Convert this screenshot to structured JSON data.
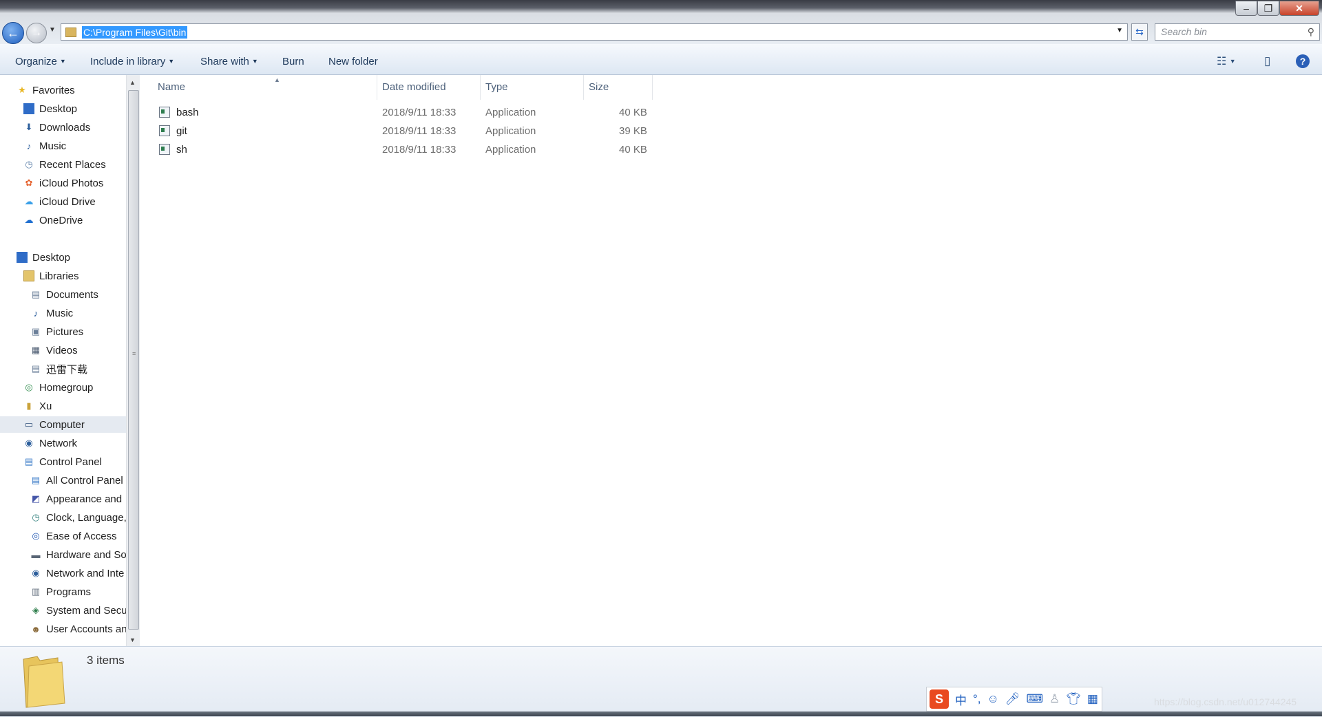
{
  "address_bar": {
    "path": "C:\\Program Files\\Git\\bin",
    "search_placeholder": "Search bin"
  },
  "toolbar": {
    "organize": "Organize",
    "include_in_library": "Include in library",
    "share_with": "Share with",
    "burn": "Burn",
    "new_folder": "New folder"
  },
  "nav": {
    "favorites": "Favorites",
    "desktop_fav": "Desktop",
    "downloads": "Downloads",
    "music_fav": "Music",
    "recent_places": "Recent Places",
    "icloud_photos": "iCloud Photos",
    "icloud_drive": "iCloud Drive",
    "onedrive": "OneDrive",
    "desktop": "Desktop",
    "libraries": "Libraries",
    "documents": "Documents",
    "music": "Music",
    "pictures": "Pictures",
    "videos": "Videos",
    "xunlei": "迅雷下载",
    "homegroup": "Homegroup",
    "xu": "Xu",
    "computer": "Computer",
    "network": "Network",
    "control_panel": "Control Panel",
    "all_control_panel": "All Control Panel",
    "appearance": "Appearance and",
    "clock": "Clock, Language,",
    "ease": "Ease of Access",
    "hardware": "Hardware and So",
    "network_inte": "Network and Inte",
    "programs": "Programs",
    "system_secu": "System and Secur",
    "user_accounts": "User Accounts an"
  },
  "columns": {
    "name": "Name",
    "date": "Date modified",
    "type": "Type",
    "size": "Size"
  },
  "files": [
    {
      "name": "bash",
      "date": "2018/9/11 18:33",
      "type": "Application",
      "size": "40 KB"
    },
    {
      "name": "git",
      "date": "2018/9/11 18:33",
      "type": "Application",
      "size": "39 KB"
    },
    {
      "name": "sh",
      "date": "2018/9/11 18:33",
      "type": "Application",
      "size": "40 KB"
    }
  ],
  "details": {
    "count": "3 items"
  },
  "ime": {
    "logo": "S",
    "mode": "中"
  },
  "watermark": "https://blog.csdn.net/u012744245"
}
